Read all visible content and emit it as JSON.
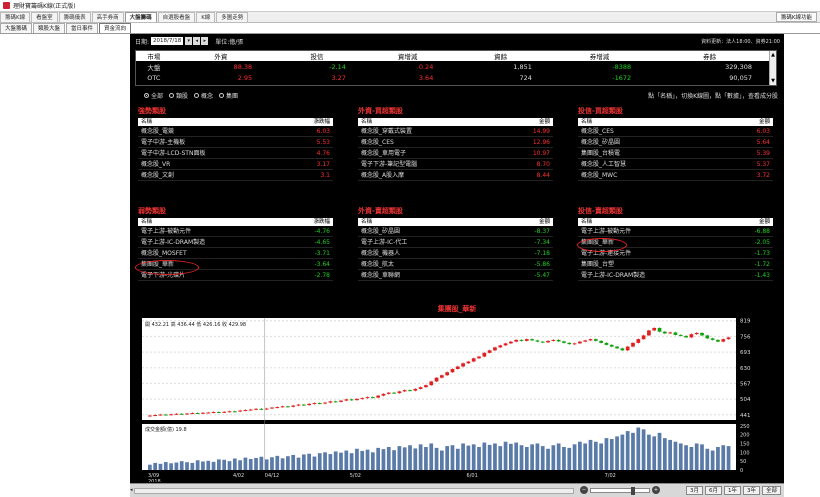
{
  "window": {
    "title": "理財寶籌碼K線(正式版)"
  },
  "tabs": [
    "籌碼K線",
    "看盤室",
    "籌碼儀表",
    "高手券商",
    "大盤籌碼",
    "自選股看盤",
    "K線",
    "多圖走勢"
  ],
  "active_tab": 4,
  "tab_right_label": "籌碼K線功能",
  "subtabs": [
    "大盤籌碼",
    "類股大盤",
    "當日事件",
    "資金流向"
  ],
  "active_subtab": 3,
  "controls": {
    "date_label": "日期:",
    "date_value": "2018/7/18",
    "unit": "單位:億/張",
    "update_note": "資料更新：法人18:00、資券21:00"
  },
  "market_table": {
    "headers": [
      "市場",
      "外資",
      "投信",
      "資增減",
      "資餘",
      "券增減",
      "券餘"
    ],
    "rows": [
      {
        "name": "大盤",
        "v": [
          "88.38",
          "-2.14",
          "0.24",
          "1,851",
          "-8388",
          "329,308"
        ],
        "c": [
          "up",
          "dn",
          "up",
          "n",
          "dn",
          "n"
        ]
      },
      {
        "name": "OTC",
        "v": [
          "2.95",
          "3.27",
          "3.64",
          "724",
          "-1672",
          "90,057"
        ],
        "c": [
          "up",
          "up",
          "up",
          "n",
          "dn",
          "n"
        ]
      }
    ]
  },
  "filter": {
    "options": [
      "全部",
      "類股",
      "概念",
      "集團"
    ],
    "selected": 0,
    "hint": "點「名稱」，切換K線圖，點「數據」，查看成分股"
  },
  "panels": [
    {
      "title": "強勢類股",
      "h1": "名稱",
      "h2": "漲跌幅",
      "rows": [
        [
          "概念股_電競",
          "6.03",
          "up"
        ],
        [
          "電子中游-主機板",
          "5.53",
          "up"
        ],
        [
          "電子中游-LCD-STN面板",
          "4.76",
          "up"
        ],
        [
          "概念股_VR",
          "3.17",
          "up"
        ],
        [
          "概念股_文創",
          "3.1",
          "up"
        ]
      ]
    },
    {
      "title": "外資-買超類股",
      "h1": "名稱",
      "h2": "金額",
      "rows": [
        [
          "概念股_穿戴式裝置",
          "14.99",
          "up"
        ],
        [
          "概念股_CES",
          "12.96",
          "up"
        ],
        [
          "概念股_車用電子",
          "10.97",
          "up"
        ],
        [
          "電子下游-筆記型電腦",
          "8.70",
          "up"
        ],
        [
          "概念股_A股入摩",
          "8.44",
          "up"
        ]
      ]
    },
    {
      "title": "投信-買超類股",
      "h1": "名稱",
      "h2": "金額",
      "rows": [
        [
          "概念股_CES",
          "6.03",
          "up"
        ],
        [
          "概念股_矽晶圓",
          "5.64",
          "up"
        ],
        [
          "集團股_台積電",
          "5.39",
          "up"
        ],
        [
          "概念股_人工智慧",
          "5.37",
          "up"
        ],
        [
          "概念股_MWC",
          "3.72",
          "up"
        ]
      ]
    },
    {
      "title": "弱勢類股",
      "h1": "名稱",
      "h2": "漲跌幅",
      "rows": [
        [
          "電子上游-被動元件",
          "-4.76",
          "dn"
        ],
        [
          "電子上游-IC-DRAM製造",
          "-4.65",
          "dn"
        ],
        [
          "概念股_MOSFET",
          "-3.71",
          "dn"
        ],
        [
          "集團股_華新",
          "-3.64",
          "dn"
        ],
        [
          "電子下游-光碟片",
          "-2.78",
          "dn"
        ]
      ]
    },
    {
      "title": "外資-賣超類股",
      "h1": "名稱",
      "h2": "金額",
      "rows": [
        [
          "概念股_矽晶圓",
          "-8.37",
          "dn"
        ],
        [
          "電子上游-IC-代工",
          "-7.34",
          "dn"
        ],
        [
          "概念股_機器人",
          "-7.18",
          "dn"
        ],
        [
          "概念股_航太",
          "-5.86",
          "dn"
        ],
        [
          "概念股_車聯網",
          "-5.47",
          "dn"
        ]
      ]
    },
    {
      "title": "投信-賣超類股",
      "h1": "名稱",
      "h2": "金額",
      "rows": [
        [
          "電子上游-被動元件",
          "-6.88",
          "dn"
        ],
        [
          "集團股_華新",
          "-2.05",
          "dn"
        ],
        [
          "電子上游-連接元件",
          "-1.73",
          "dn"
        ],
        [
          "集團股_台塑",
          "-1.72",
          "dn"
        ],
        [
          "電子上游-IC-DRAM製造",
          "-1.43",
          "dn"
        ]
      ]
    }
  ],
  "chart_data": {
    "type": "candlestick",
    "title": "集團股_華新",
    "ohlc_label": "開 432.21  高 436.44  低 426.16  收 429.98",
    "volume_label": "成交金額(億) 19.8",
    "price_ticks": [
      819,
      756,
      693,
      630,
      567,
      504,
      441
    ],
    "price_range": [
      420,
      830
    ],
    "volume_ticks": [
      250,
      200,
      150,
      100,
      50,
      0
    ],
    "volume_range": [
      0,
      260
    ],
    "x_labels": [
      "3/09\n2018",
      "4/02",
      "04/12",
      "5/02",
      "6/01",
      "7/02"
    ],
    "close": [
      438,
      440,
      442,
      441,
      443,
      445,
      444,
      446,
      448,
      447,
      449,
      450,
      452,
      451,
      453,
      455,
      454,
      458,
      460,
      462,
      465,
      463,
      466,
      470,
      472,
      475,
      473,
      478,
      482,
      480,
      485,
      488,
      486,
      490,
      495,
      493,
      498,
      503,
      500,
      505,
      508,
      512,
      510,
      518,
      525,
      530,
      528,
      535,
      540,
      538,
      545,
      552,
      560,
      575,
      590,
      600,
      612,
      625,
      635,
      648,
      655,
      668,
      675,
      690,
      700,
      712,
      720,
      728,
      735,
      742,
      738,
      745,
      740,
      735,
      732,
      738,
      742,
      736,
      730,
      725,
      728,
      735,
      740,
      745,
      738,
      730,
      722,
      715,
      708,
      700,
      715,
      730,
      745,
      760,
      780,
      790,
      775,
      768,
      772,
      762,
      758,
      752,
      765,
      770,
      760,
      748,
      742,
      735,
      745,
      752
    ],
    "volume": [
      30,
      40,
      35,
      45,
      38,
      42,
      50,
      44,
      40,
      55,
      48,
      52,
      46,
      60,
      58,
      50,
      65,
      55,
      70,
      62,
      68,
      75,
      60,
      72,
      80,
      66,
      78,
      85,
      70,
      88,
      92,
      76,
      95,
      100,
      90,
      105,
      98,
      110,
      95,
      120,
      108,
      115,
      100,
      125,
      118,
      130,
      112,
      135,
      128,
      140,
      122,
      145,
      130,
      150,
      125,
      110,
      135,
      140,
      120,
      150,
      138,
      145,
      130,
      155,
      142,
      150,
      135,
      160,
      148,
      155,
      140,
      130,
      145,
      150,
      135,
      120,
      140,
      150,
      130,
      125,
      145,
      160,
      150,
      170,
      160,
      150,
      180,
      175,
      190,
      200,
      220,
      210,
      240,
      230,
      200,
      190,
      210,
      180,
      170,
      160,
      150,
      140,
      130,
      150,
      145,
      120,
      110,
      130,
      140,
      135
    ]
  }
}
